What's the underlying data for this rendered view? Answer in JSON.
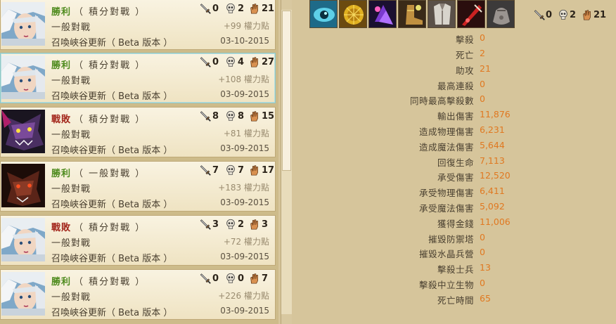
{
  "match_list": [
    {
      "result": "勝利",
      "result_type": "win",
      "queue": "（ 積分對戰 ）",
      "mode": "一般對戰",
      "map": "召喚峽谷更新（ Beta 版本 ）",
      "kills": "0",
      "deaths": "2",
      "assists": "21",
      "ip": "+99 權力點",
      "date": "03-10-2015",
      "avatar": "white-hair-champion"
    },
    {
      "result": "勝利",
      "result_type": "win",
      "queue": "（ 積分對戰 ）",
      "mode": "一般對戰",
      "map": "召喚峽谷更新（ Beta 版本 ）",
      "kills": "0",
      "deaths": "4",
      "assists": "27",
      "ip": "+108 權力點",
      "date": "03-09-2015",
      "avatar": "white-hair-champion"
    },
    {
      "result": "戰敗",
      "result_type": "lose",
      "queue": "（ 積分對戰 ）",
      "mode": "一般對戰",
      "map": "召喚峽谷更新（ Beta 版本 ）",
      "kills": "8",
      "deaths": "8",
      "assists": "15",
      "ip": "+81 權力點",
      "date": "03-09-2015",
      "avatar": "purple-beast-champion"
    },
    {
      "result": "勝利",
      "result_type": "win",
      "queue": "（ 一般對戰 ）",
      "mode": "一般對戰",
      "map": "召喚峽谷更新（ Beta 版本 ）",
      "kills": "7",
      "deaths": "7",
      "assists": "17",
      "ip": "+183 權力點",
      "date": "03-09-2015",
      "avatar": "red-beast-champion"
    },
    {
      "result": "戰敗",
      "result_type": "lose",
      "queue": "（ 積分對戰 ）",
      "mode": "一般對戰",
      "map": "召喚峽谷更新（ Beta 版本 ）",
      "kills": "3",
      "deaths": "2",
      "assists": "3",
      "ip": "+72 權力點",
      "date": "03-09-2015",
      "avatar": "white-hair-champion"
    },
    {
      "result": "勝利",
      "result_type": "win",
      "queue": "（ 積分對戰 ）",
      "mode": "一般對戰",
      "map": "召喚峽谷更新（ Beta 版本 ）",
      "kills": "0",
      "deaths": "0",
      "assists": "7",
      "ip": "+226 權力點",
      "date": "03-09-2015",
      "avatar": "white-hair-champion"
    }
  ],
  "detail": {
    "items": [
      "eye-item-icon",
      "gold-sun-item-icon",
      "purple-crystal-item-icon",
      "boots-item-icon",
      "armor-vest-item-icon",
      "red-blade-item-icon",
      "gray-pouch-item-icon"
    ],
    "kills": "0",
    "deaths": "2",
    "assists": "21",
    "stats": [
      {
        "label": "擊殺",
        "value": "0"
      },
      {
        "label": "死亡",
        "value": "2"
      },
      {
        "label": "助攻",
        "value": "21"
      },
      {
        "label": "最高連殺",
        "value": "0"
      },
      {
        "label": "同時最高擊殺數",
        "value": "0"
      },
      {
        "label": "輸出傷害",
        "value": "11,876"
      },
      {
        "label": "造成物理傷害",
        "value": "6,231"
      },
      {
        "label": "造成魔法傷害",
        "value": "5,644"
      },
      {
        "label": "回復生命",
        "value": "7,113"
      },
      {
        "label": "承受傷害",
        "value": "12,520"
      },
      {
        "label": "承受物理傷害",
        "value": "6,411"
      },
      {
        "label": "承受魔法傷害",
        "value": "5,092"
      },
      {
        "label": "獲得金錢",
        "value": "11,006"
      },
      {
        "label": "摧毀防禦塔",
        "value": "0"
      },
      {
        "label": "摧毀水晶兵營",
        "value": "0"
      },
      {
        "label": "擊殺士兵",
        "value": "13"
      },
      {
        "label": "擊殺中立生物",
        "value": "0"
      },
      {
        "label": "死亡時間",
        "value": "65"
      }
    ]
  },
  "colors": {
    "win": "#4d8a1c",
    "lose": "#a3271c",
    "stat_value": "#e07820",
    "panel_bg": "#d6c59b"
  }
}
